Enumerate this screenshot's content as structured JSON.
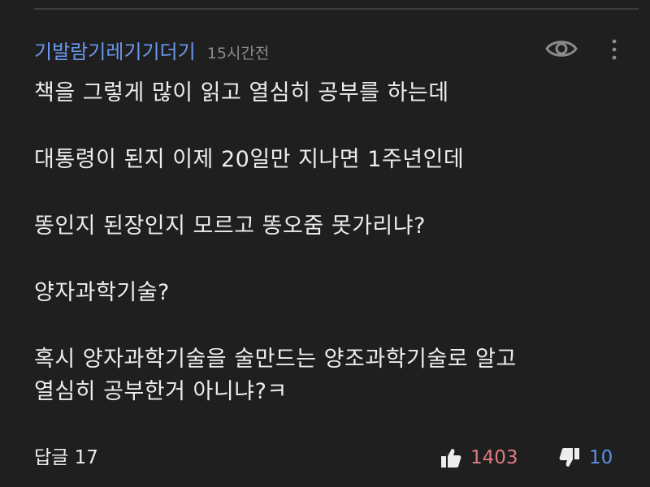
{
  "comment": {
    "author": "기발람기레기기더기",
    "timestamp": "15시간전",
    "lines": [
      "책을 그렇게 많이 읽고 열심히 공부를 하는데",
      "대통령이 된지 이제 20일만 지나면 1주년인데",
      "똥인지 된장인지 모르고 똥오줌 못가리냐?",
      "양자과학기술?",
      "혹시 양자과학기술을 술만드는 양조과학기술로 알고",
      "열심히 공부한거 아니냐?ㅋ"
    ]
  },
  "footer": {
    "reply_label": "답글 17",
    "like_count": "1403",
    "dislike_count": "10"
  },
  "colors": {
    "background": "#1f1f1f",
    "author": "#6a98ee",
    "like": "#e07a7f",
    "dislike": "#5f8fe5"
  },
  "icons": {
    "view": "eye-icon",
    "menu": "more-vertical-icon",
    "like": "thumbs-up-icon",
    "dislike": "thumbs-down-icon"
  }
}
